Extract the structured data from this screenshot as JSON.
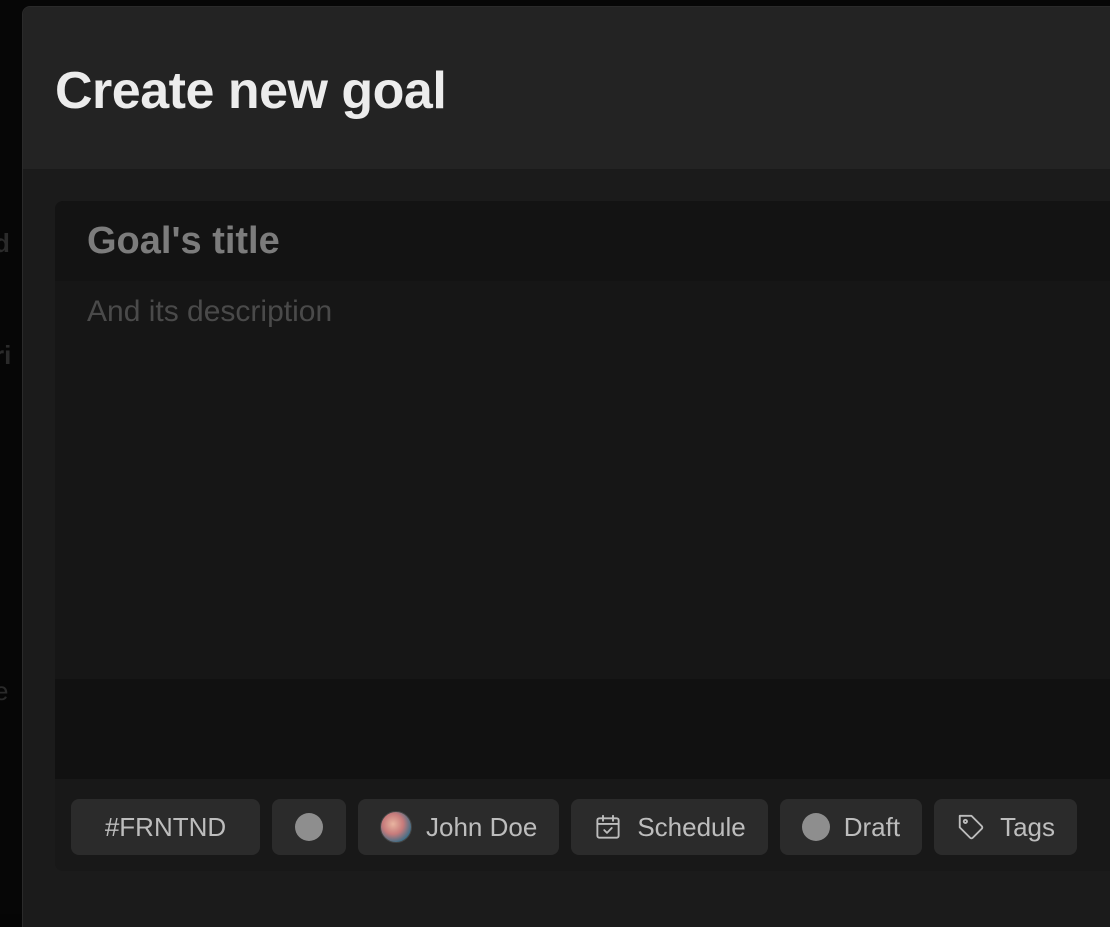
{
  "modal": {
    "title": "Create new goal"
  },
  "form": {
    "title_placeholder": "Goal's title",
    "description_placeholder": "And its description"
  },
  "toolbar": {
    "project_label": "#FRNTND",
    "priority_icon": "circle-icon",
    "assignee_label": "John Doe",
    "assignee_icon": "avatar",
    "schedule_label": "Schedule",
    "schedule_icon": "calendar-check-icon",
    "status_label": "Draft",
    "status_icon": "circle-icon",
    "tags_label": "Tags",
    "tags_icon": "tag-icon"
  },
  "colors": {
    "modal_bg": "#1b1b1b",
    "header_bg": "#232323",
    "chip_bg": "#2b2b2b",
    "status_dot": "#8e8e8e"
  }
}
